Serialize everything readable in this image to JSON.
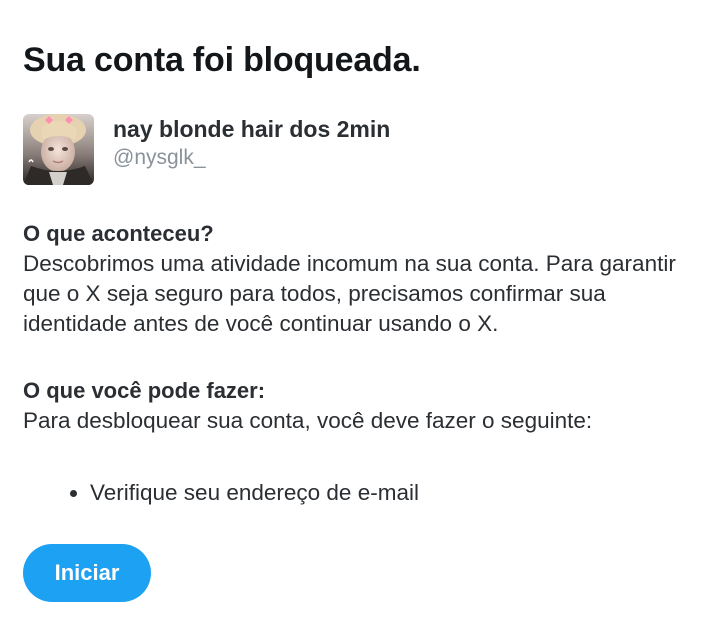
{
  "page": {
    "title": "Sua conta foi bloqueada."
  },
  "account": {
    "display_name": "nay blonde hair dos 2min",
    "handle": "@nysglk_"
  },
  "what_happened": {
    "heading": "O que aconteceu?",
    "body": "Descobrimos uma atividade incomum na sua conta. Para garantir que o X seja seguro para todos, precisamos confirmar sua identidade antes de você continuar usando o X."
  },
  "what_to_do": {
    "heading": "O que você pode fazer:",
    "body": "Para desbloquear sua conta, você deve fazer o seguinte:",
    "steps": [
      "Verifique seu endereço de e-mail"
    ]
  },
  "actions": {
    "start_label": "Iniciar"
  },
  "colors": {
    "accent": "#1da1f2",
    "text": "#2b2f33",
    "muted": "#8a9299"
  }
}
